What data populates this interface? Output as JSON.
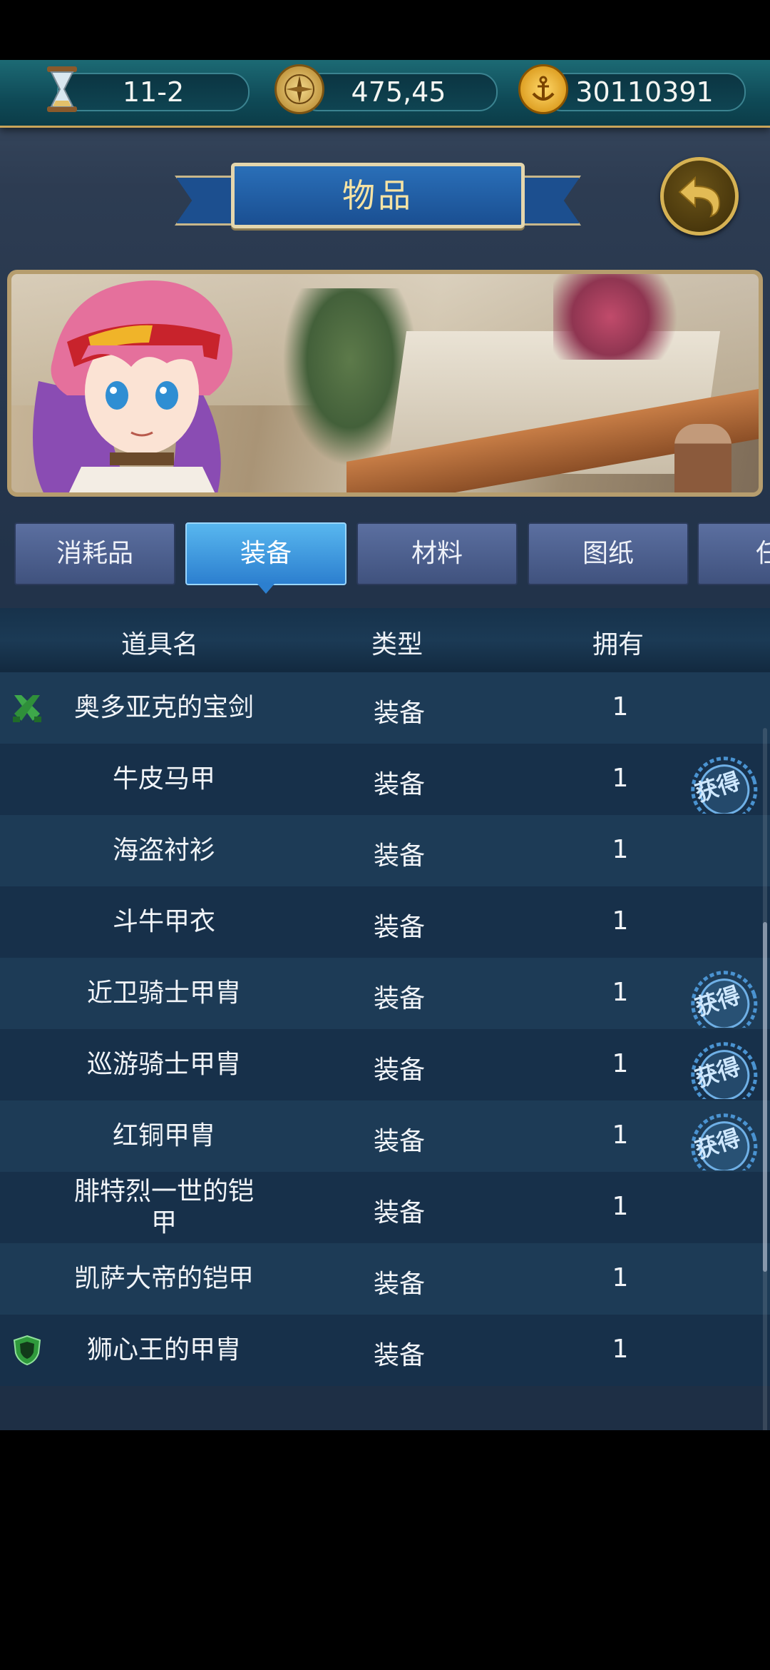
{
  "resources": {
    "stage": "11-2",
    "coordinates": "475,45",
    "gold": "30110391"
  },
  "header": {
    "title": "物品"
  },
  "tabs": [
    {
      "label": "消耗品",
      "active": false
    },
    {
      "label": "装备",
      "active": true
    },
    {
      "label": "材料",
      "active": false
    },
    {
      "label": "图纸",
      "active": false
    },
    {
      "label": "任",
      "active": false
    }
  ],
  "table": {
    "headers": {
      "name": "道具名",
      "type": "类型",
      "owned": "拥有"
    },
    "rows": [
      {
        "name": "奥多亚克的宝剑",
        "type": "装备",
        "owned": "1",
        "icon": "crossed-swords-icon",
        "acquired": false
      },
      {
        "name": "牛皮马甲",
        "type": "装备",
        "owned": "1",
        "icon": "",
        "acquired": true
      },
      {
        "name": "海盗衬衫",
        "type": "装备",
        "owned": "1",
        "icon": "",
        "acquired": false
      },
      {
        "name": "斗牛甲衣",
        "type": "装备",
        "owned": "1",
        "icon": "",
        "acquired": false
      },
      {
        "name": "近卫骑士甲胄",
        "type": "装备",
        "owned": "1",
        "icon": "",
        "acquired": true
      },
      {
        "name": "巡游骑士甲胄",
        "type": "装备",
        "owned": "1",
        "icon": "",
        "acquired": true
      },
      {
        "name": "红铜甲胄",
        "type": "装备",
        "owned": "1",
        "icon": "",
        "acquired": true
      },
      {
        "name": "腓特烈一世的铠甲",
        "type": "装备",
        "owned": "1",
        "icon": "",
        "acquired": false
      },
      {
        "name": "凯萨大帝的铠甲",
        "type": "装备",
        "owned": "1",
        "icon": "",
        "acquired": false
      },
      {
        "name": "狮心王的甲胄",
        "type": "装备",
        "owned": "1",
        "icon": "shield-icon",
        "acquired": false
      }
    ],
    "stamp_label": "获得"
  },
  "colors": {
    "accent": "#2c7fcf",
    "gold": "#d6b253",
    "row_odd": "#1d3b56",
    "row_even": "#17304a"
  }
}
